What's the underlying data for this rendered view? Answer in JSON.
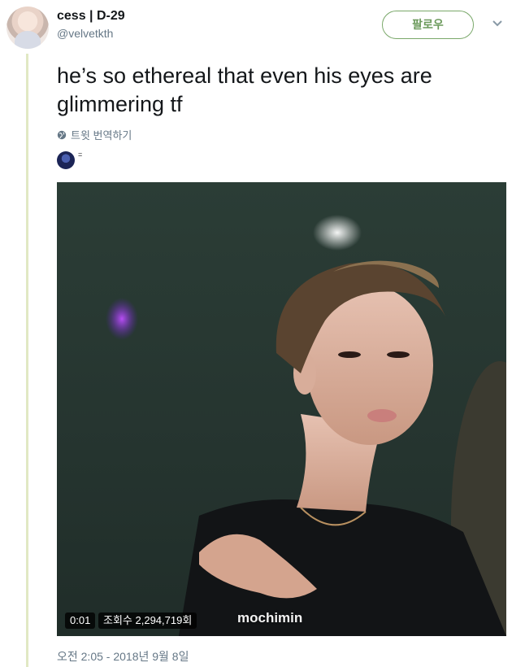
{
  "author": {
    "display_name": "cess | D-29",
    "handle": "@velvetkth"
  },
  "follow_button_label": "팔로우",
  "tweet_text": "he’s so ethereal that even his eyes are glimmering tf",
  "translate_label": "트윗 번역하기",
  "video": {
    "time": "0:01",
    "views": "조회수 2,294,719회",
    "watermark": "mochimin"
  },
  "timestamp": "오전 2:05 - 2018년 9월 8일",
  "colors": {
    "accent_green": "#6c9a5c",
    "thread_line": "#e1e8c4",
    "muted_text": "#657786"
  }
}
